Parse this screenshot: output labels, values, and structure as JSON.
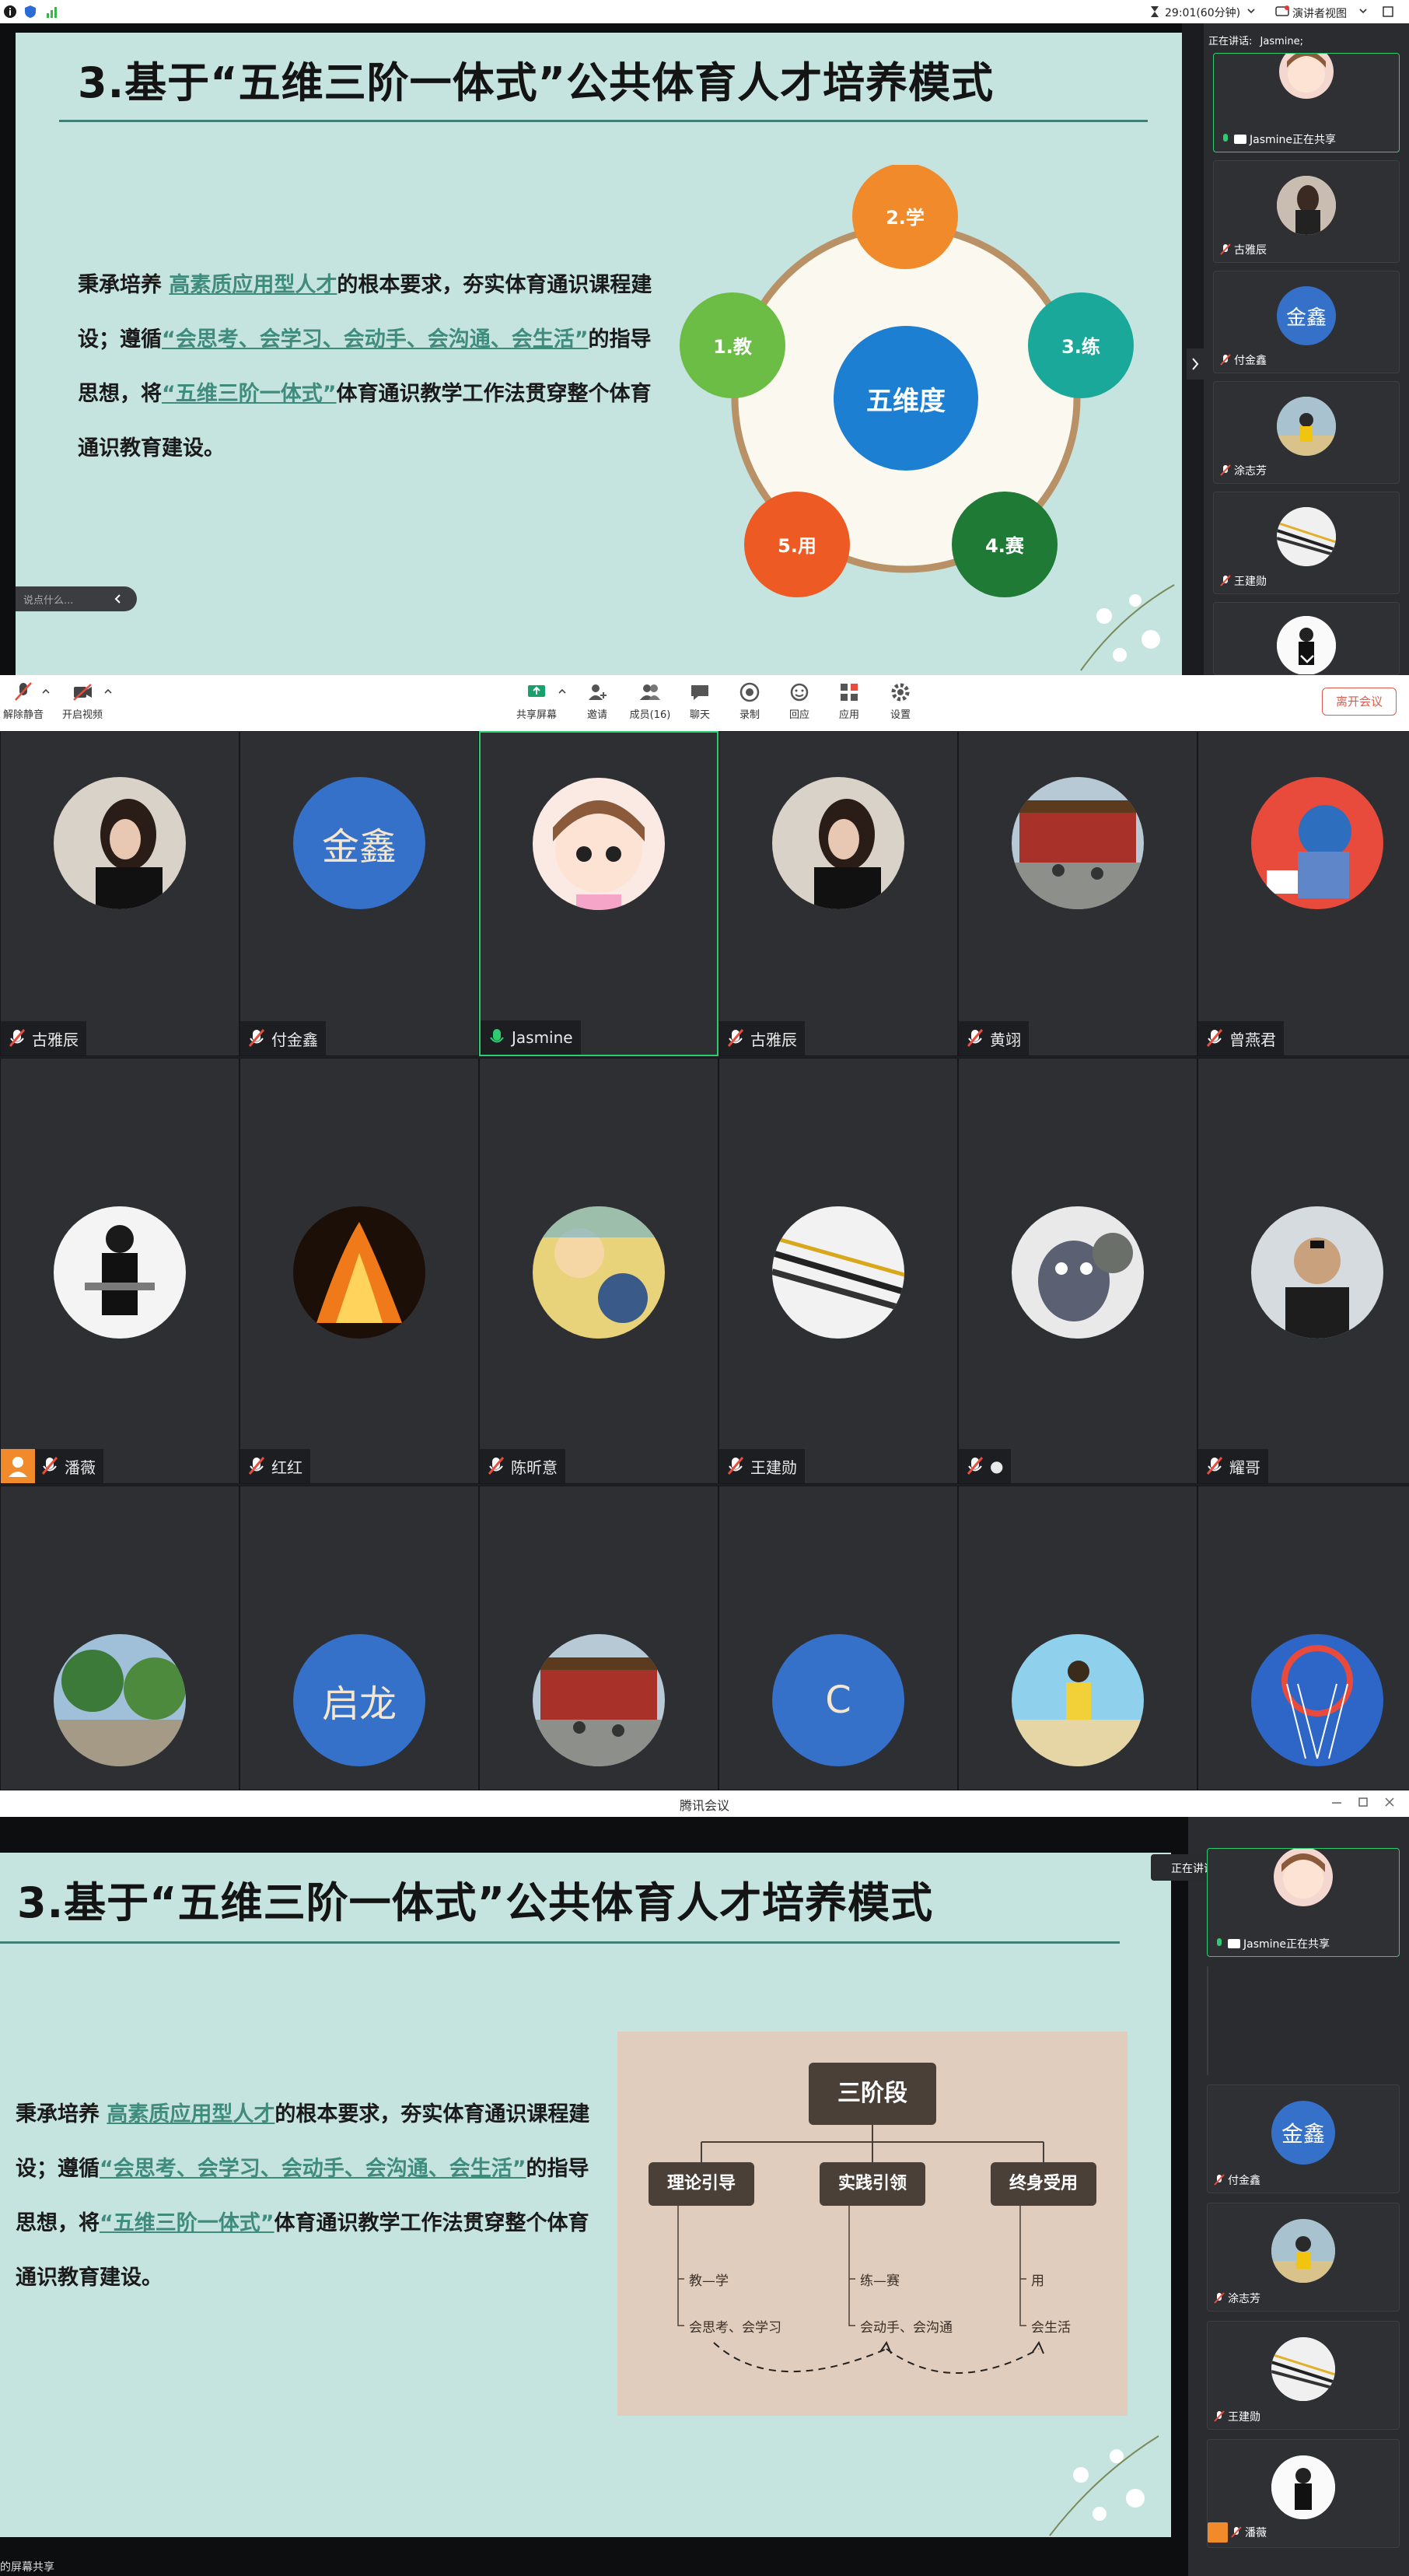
{
  "status_bar": {
    "timer": "29:01(60分钟)",
    "view_label": "演讲者视图"
  },
  "slide": {
    "title": "3.基于“五维三阶一体式”公共体育人才培养模式",
    "body_parts": [
      "秉承培养 ",
      "高素质应用型人才",
      "的根本要求，夯实体育通识课程建设；遵循",
      "“会思考、会学习、会动手、会沟通、会生活”",
      "的指导思想，将",
      "“五维三阶一体式”",
      "体育通识教学工作法贯穿整个体育通识教育建设。"
    ],
    "body_parts_2": [
      "秉承培养 ",
      "高素质应用型人才",
      "的根本要求，夯实体育通识课程建设；遵循",
      "“会思考、会学习、会动手、会沟通、会生活”",
      "的指导思想，将",
      "“五维三阶一体式”",
      "体育通识教学工作法贯穿整个体育通识教育建设。"
    ],
    "center": "五维度",
    "nodes": [
      {
        "label": "2.学",
        "color": "#f08a2a"
      },
      {
        "label": "3.练",
        "color": "#1aa89a"
      },
      {
        "label": "4.赛",
        "color": "#1e7a35"
      },
      {
        "label": "5.用",
        "color": "#ee5a24"
      },
      {
        "label": "1.教",
        "color": "#6cbd45"
      }
    ],
    "center_color": "#1c7fd1",
    "comment_placeholder": "说点什么..."
  },
  "tree": {
    "root": "三阶段",
    "branches": [
      {
        "label": "理论引导",
        "items": [
          "教—学",
          "会思考、会学习"
        ]
      },
      {
        "label": "实践引领",
        "items": [
          "练—赛",
          "会动手、会沟通"
        ]
      },
      {
        "label": "终身受用",
        "items": [
          "用",
          "会生活"
        ]
      }
    ]
  },
  "side_panel": {
    "speaking_label": "正在讲话:",
    "speaker": "Jasmine;",
    "sharing_label": "Jasmine正在共享",
    "participants": [
      "古雅辰",
      "付金鑫",
      "涂志芳",
      "王建勋"
    ],
    "jinxin_avatar_text": "金鑫",
    "extra_participant": "潘薇"
  },
  "toolbar": {
    "unmute": "解除静音",
    "video": "开启视频",
    "items": [
      "共享屏幕",
      "邀请",
      "成员(16)",
      "聊天",
      "录制",
      "回应",
      "应用",
      "设置"
    ],
    "leave": "离开会议"
  },
  "gallery": {
    "row1": [
      {
        "name": "古雅辰",
        "kind": "photo_woman"
      },
      {
        "name": "付金鑫",
        "kind": "text",
        "text": "金鑫"
      },
      {
        "name": "Jasmine",
        "kind": "cartoon",
        "active": true
      },
      {
        "name": "古雅辰",
        "kind": "photo_woman"
      },
      {
        "name": "黄翊",
        "kind": "photo_temple"
      },
      {
        "name": "曾燕君",
        "kind": "photo_mascot"
      }
    ],
    "row2": [
      {
        "name": "潘薇",
        "kind": "photo_suit"
      },
      {
        "name": "红红",
        "kind": "photo_fire"
      },
      {
        "name": "陈昕意",
        "kind": "photo_anime"
      },
      {
        "name": "王建勋",
        "kind": "photo_arrows"
      },
      {
        "name": "●",
        "kind": "photo_cat"
      },
      {
        "name": "耀哥",
        "kind": "photo_man"
      }
    ],
    "row3": [
      {
        "name": "",
        "kind": "photo_park"
      },
      {
        "name": "",
        "kind": "text",
        "text": "启龙"
      },
      {
        "name": "",
        "kind": "photo_temple"
      },
      {
        "name": "",
        "kind": "text",
        "text": "C"
      },
      {
        "name": "",
        "kind": "photo_beach"
      },
      {
        "name": "",
        "kind": "photo_hoop"
      }
    ]
  },
  "window2": {
    "title": "腾讯会议",
    "footer": "的屏幕共享"
  }
}
